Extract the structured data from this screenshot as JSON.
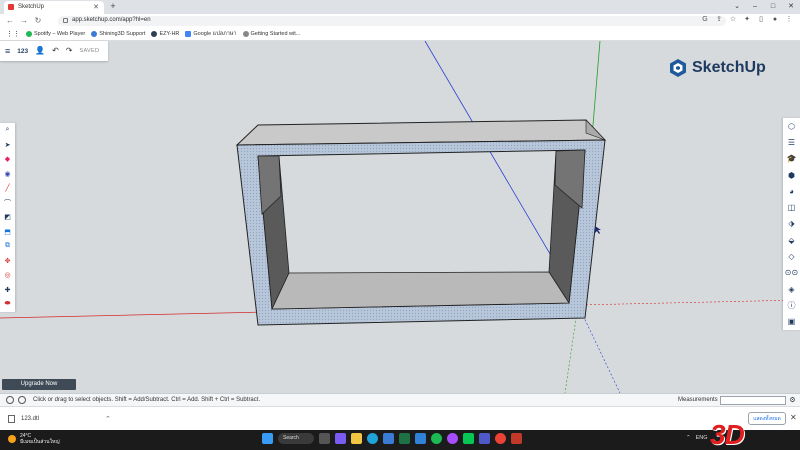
{
  "browser": {
    "tab_title": "SketchUp",
    "url": "app.sketchup.com/app?hl=en",
    "bookmarks": [
      {
        "label": "Spotify – Web Player",
        "color": "#1db954"
      },
      {
        "label": "Shining3D Support",
        "color": "#3a7bd5"
      },
      {
        "label": "EZY-HR",
        "color": "#2c3e50"
      },
      {
        "label": "Google แปลภาษา",
        "color": "#4285f4"
      },
      {
        "label": "Getting Started wit...",
        "color": "#888888"
      }
    ]
  },
  "toolbar": {
    "file_name": "123",
    "saved_label": "SAVED"
  },
  "logo": {
    "text": "SketchUp"
  },
  "upgrade": {
    "label": "Upgrade Now"
  },
  "status": {
    "message": "Click or drag to select objects. Shift = Add/Subtract. Ctrl = Add. Shift + Ctrl = Subtract.",
    "measurements_label": "Measurements",
    "measurements_value": ""
  },
  "downloads": {
    "file": "123.dtl",
    "show_all": "แสดงทั้งหมด"
  },
  "taskbar": {
    "temperature": "24°C",
    "weather_text": "มีเมฆเป็นส่วนใหญ่",
    "search_label": "Search",
    "lang": "ENG"
  },
  "watermark": "3D",
  "colors": {
    "accent": "#1f3a5f",
    "axis_red": "#d12b2b",
    "axis_green": "#22a022",
    "axis_blue": "#2b3fd1"
  }
}
